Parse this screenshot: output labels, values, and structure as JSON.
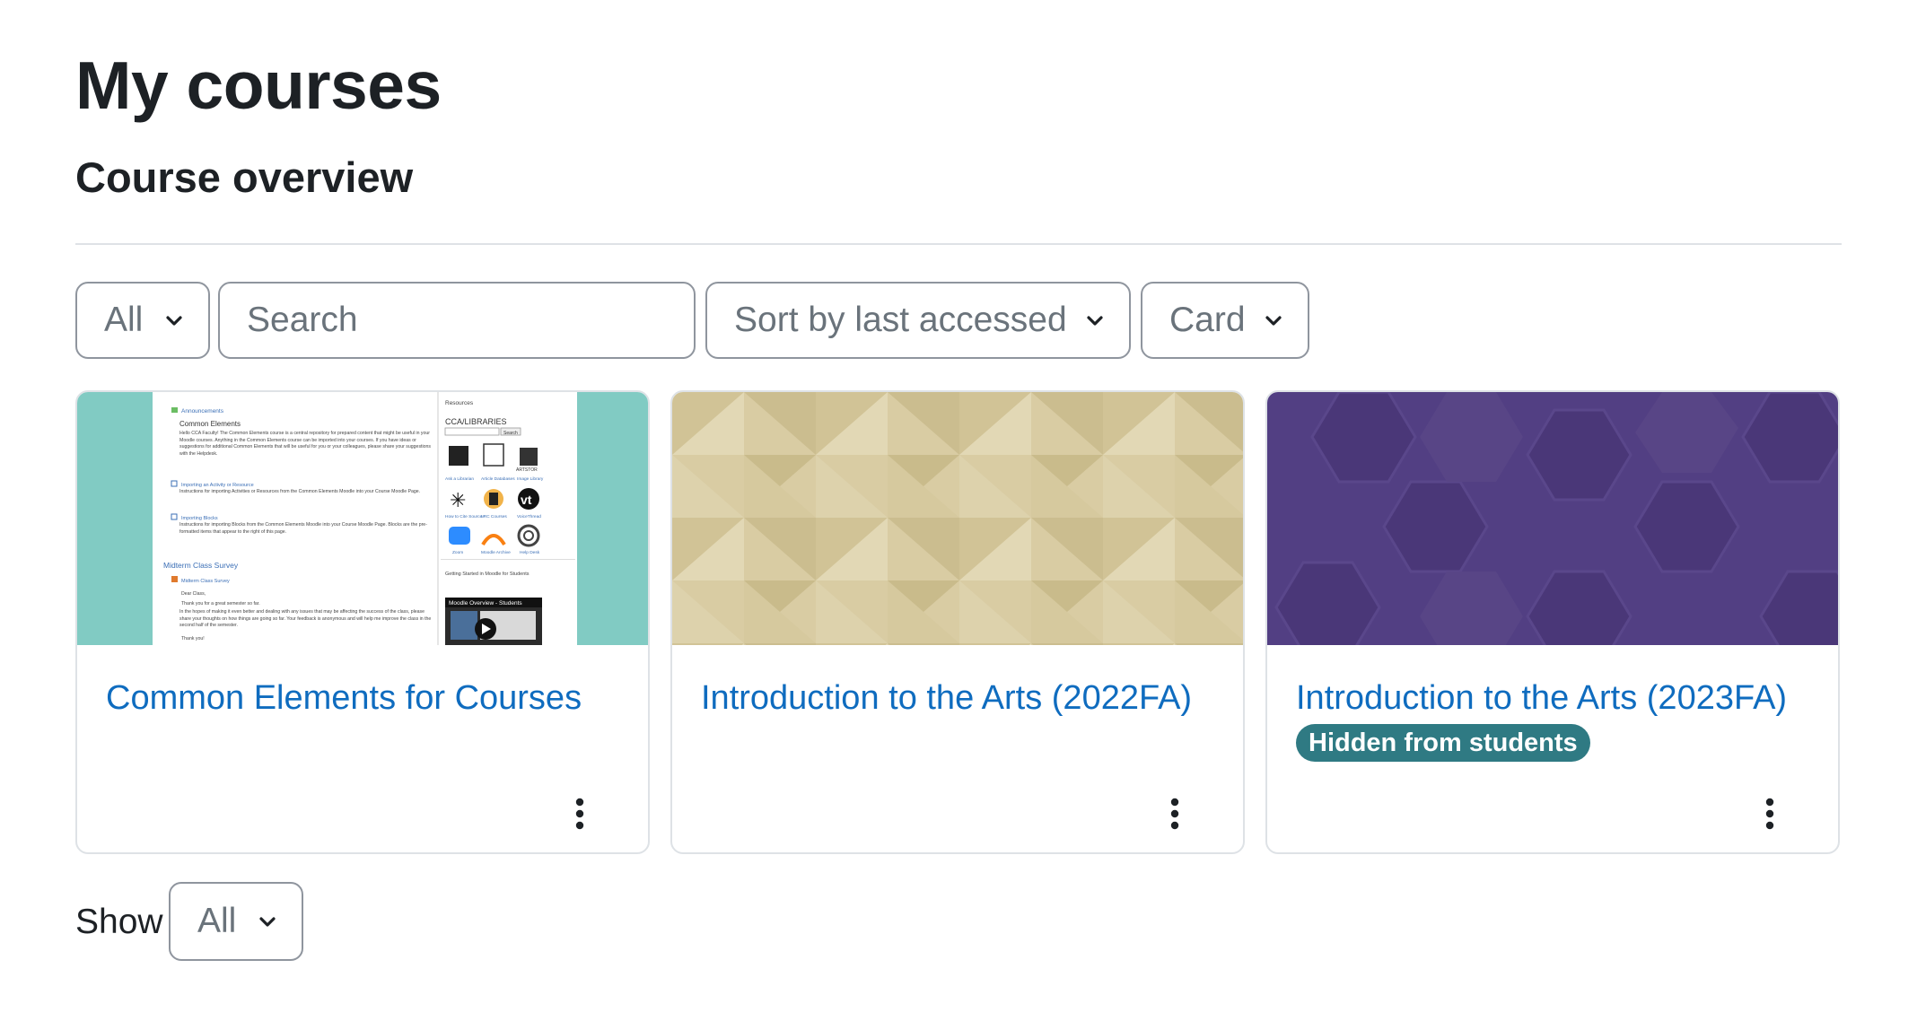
{
  "page": {
    "title": "My courses"
  },
  "section": {
    "title": "Course overview"
  },
  "filters": {
    "grouping": {
      "selected": "All"
    },
    "search": {
      "placeholder": "Search"
    },
    "sort": {
      "selected": "Sort by last accessed"
    },
    "view": {
      "selected": "Card"
    }
  },
  "courses": [
    {
      "title": "Common Elements for Courses",
      "image": "screenshot-thumbnail",
      "thumbnail_text": {
        "announcements": "Announcements",
        "common_elements": "Common Elements",
        "intro": "Hello CCA Faculty! The Common Elements course is a central repository for prepared content that might be useful in your Moodle courses. Anything in the Common Elements course can be imported into your courses. If you have ideas or suggestions for additional Common Elements that will be useful for you or your colleagues, please share your suggestions with the Helpdesk.",
        "importing_activity": "Importing an Activity or Resource",
        "importing_activity_desc": "Instructions for importing Activities or Resources from the Common Elements Moodle into your Course Moodle Page.",
        "importing_blocks": "Importing Blocks",
        "importing_blocks_desc": "Instructions for importing Blocks from the Common Elements Moodle into your Course Moodle Page. Blocks are the pre-formatted items that appear to the right of this page.",
        "midterm_title": "Midterm Class Survey",
        "midterm_link": "Midterm Class Survey",
        "letter": [
          "Dear Class,",
          "Thank you for a great semester so far.",
          "In the hopes of making it even better and dealing with any issues that may be affecting the success of the class, please share your thoughts on how things are going so far. Your feedback is anonymous and will help me improve the class in the second half of the semester.",
          "Thank you!"
        ],
        "resources": "Resources",
        "libraries": "CCA/LIBRARIES",
        "search_btn": "Search",
        "res_items": [
          "Ask a Librarian",
          "Article Databases",
          "Image Library",
          "How to Cite Sources",
          "LRC Courses",
          "VoiceThread",
          "Zoom",
          "Moodle Archive",
          "Help Desk"
        ],
        "artstor": "ARTSTOR",
        "getting_started": "Getting Started in Moodle for Students",
        "video_title": "Moodle Overview - Students"
      }
    },
    {
      "title": "Introduction to the Arts (2022FA)",
      "image": "beige-triangle-pattern"
    },
    {
      "title": "Introduction to the Arts (2023FA)",
      "image": "purple-hexagon-pattern",
      "badge": "Hidden from students"
    }
  ],
  "footer": {
    "show_label": "Show",
    "show_selected": "All"
  },
  "colors": {
    "link": "#0f6cbf",
    "badge": "#2f7a83",
    "teal_thumb": "#81cbc3",
    "beige": "#d9cca3",
    "purple": "#523f83"
  }
}
